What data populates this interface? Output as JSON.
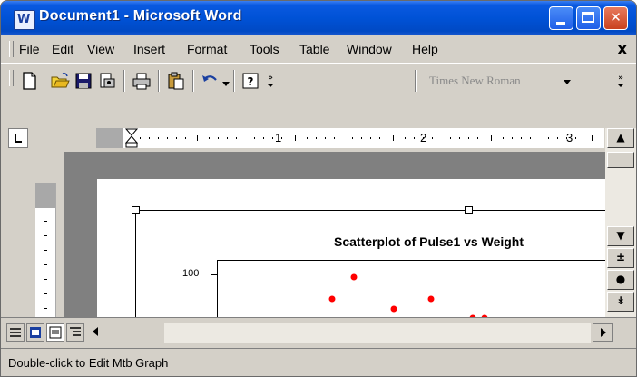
{
  "window": {
    "title": "Document1 - Microsoft Word"
  },
  "title_buttons": [
    "minimize",
    "maximize",
    "close"
  ],
  "menu": {
    "items": [
      "File",
      "Edit",
      "View",
      "Insert",
      "Format",
      "Tools",
      "Table",
      "Window",
      "Help"
    ],
    "close_glyph": "x"
  },
  "toolbar": {
    "buttons": [
      "new-icon",
      "open-icon",
      "save-icon",
      "permission-icon",
      "print-icon",
      "paste-icon",
      "undo-icon",
      "help-icon",
      "toolbar-options-icon"
    ],
    "font_name": "Times New Roman"
  },
  "ruler": {
    "numbers": [
      "1",
      "2",
      "3"
    ]
  },
  "graph": {
    "title": "Scatterplot of Pulse1 vs Weight",
    "ytick": "100",
    "point_color": "#ff0000",
    "point_count": 7
  },
  "status_bar": {
    "text": "Double-click to Edit Mtb Graph"
  },
  "colors": {
    "titlebar": "#0052d6",
    "chrome": "#d4d0c8",
    "close_button": "#c9421f"
  }
}
